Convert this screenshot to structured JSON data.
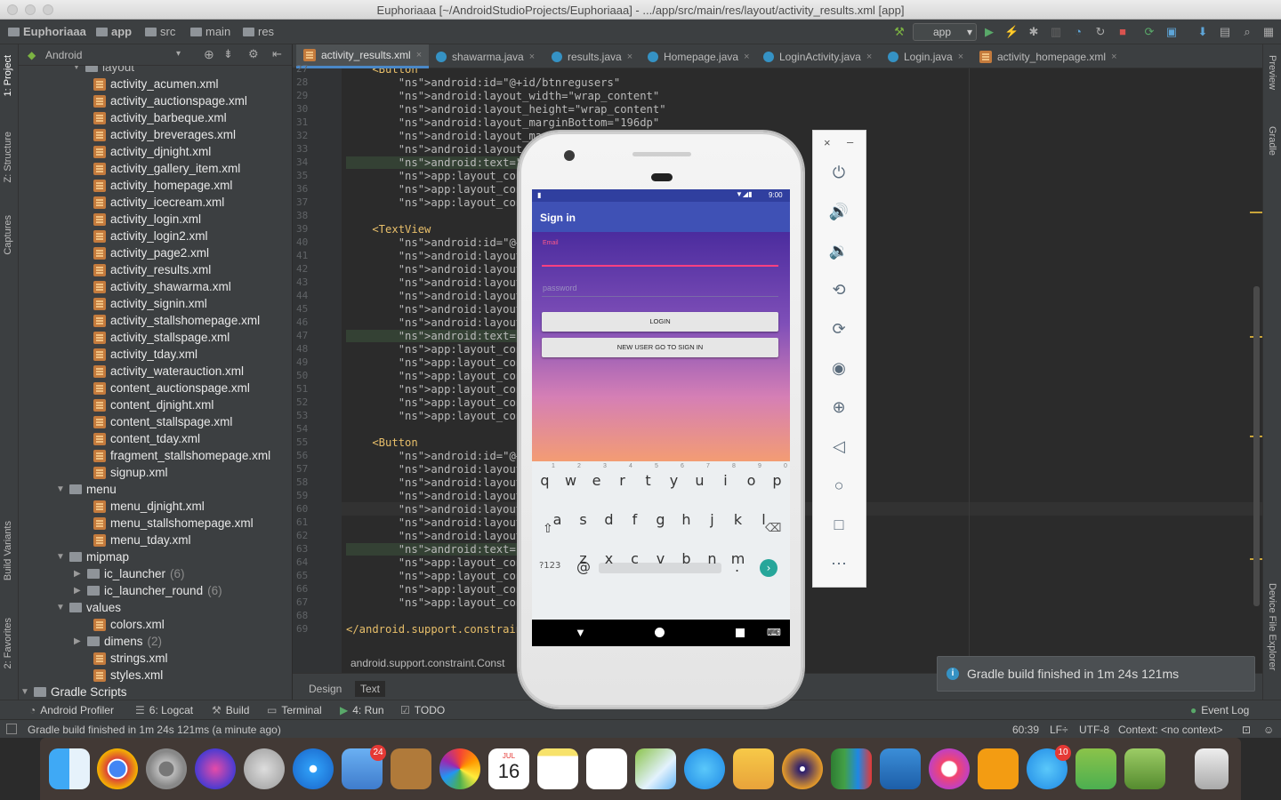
{
  "window": {
    "title": "Euphoriaaa [~/AndroidStudioProjects/Euphoriaaa] - .../app/src/main/res/layout/activity_results.xml [app]"
  },
  "breadcrumbs": [
    "Euphoriaaa",
    "app",
    "src",
    "main",
    "res"
  ],
  "run_config": "app",
  "left_tabs": [
    "1: Project",
    "Z: Structure",
    "Captures",
    "Build Variants",
    "2: Favorites"
  ],
  "right_tabs": [
    "Preview",
    "Gradle",
    "Device File Explorer"
  ],
  "project_panel": {
    "view_selector": "Android",
    "root_partial": "layout",
    "layout_files": [
      "activity_acumen.xml",
      "activity_auctionspage.xml",
      "activity_barbeque.xml",
      "activity_breverages.xml",
      "activity_djnight.xml",
      "activity_gallery_item.xml",
      "activity_homepage.xml",
      "activity_icecream.xml",
      "activity_login.xml",
      "activity_login2.xml",
      "activity_page2.xml",
      "activity_results.xml",
      "activity_shawarma.xml",
      "activity_signin.xml",
      "activity_stallshomepage.xml",
      "activity_stallspage.xml",
      "activity_tday.xml",
      "activity_waterauction.xml",
      "content_auctionspage.xml",
      "content_djnight.xml",
      "content_stallspage.xml",
      "content_tday.xml",
      "fragment_stallshomepage.xml",
      "signup.xml"
    ],
    "menu_folder": "menu",
    "menu_files": [
      "menu_djnight.xml",
      "menu_stallshomepage.xml",
      "menu_tday.xml"
    ],
    "mipmap_folder": "mipmap",
    "mipmap_items": [
      {
        "name": "ic_launcher",
        "count": "(6)"
      },
      {
        "name": "ic_launcher_round",
        "count": "(6)"
      }
    ],
    "values_folder": "values",
    "values_items": [
      {
        "name": "colors.xml",
        "count": ""
      },
      {
        "name": "dimens",
        "count": "(2)"
      },
      {
        "name": "strings.xml",
        "count": ""
      },
      {
        "name": "styles.xml",
        "count": ""
      }
    ],
    "gradle_scripts": "Gradle Scripts"
  },
  "editor_tabs": [
    "activity_results.xml",
    "shawarma.java",
    "results.java",
    "Homepage.java",
    "LoginActivity.java",
    "Login.java",
    "activity_homepage.xml"
  ],
  "line_numbers": [
    "27",
    "28",
    "29",
    "30",
    "31",
    "32",
    "33",
    "34",
    "35",
    "36",
    "37",
    "38",
    "39",
    "40",
    "41",
    "42",
    "43",
    "44",
    "45",
    "46",
    "47",
    "48",
    "49",
    "50",
    "51",
    "52",
    "53",
    "54",
    "55",
    "56",
    "57",
    "58",
    "59",
    "60",
    "61",
    "62",
    "63",
    "64",
    "65",
    "66",
    "67",
    "68",
    "69"
  ],
  "code_lines": [
    {
      "t": "    <Button",
      "c": "tag"
    },
    {
      "t": "        android:id=\"@+id/btnregusers\"",
      "c": "attr"
    },
    {
      "t": "        android:layout_width=\"wrap_content\"",
      "c": "attr"
    },
    {
      "t": "        android:layout_height=\"wrap_content\"",
      "c": "attr"
    },
    {
      "t": "        android:layout_marginBottom=\"196dp\"",
      "c": "attr"
    },
    {
      "t": "        android:layout_marginEnd",
      "c": "attr"
    },
    {
      "t": "        android:layout_margin",
      "c": "attr"
    },
    {
      "t": "        android:text=\"Get re",
      "c": "hl"
    },
    {
      "t": "        app:layout_constrain",
      "c": "attr"
    },
    {
      "t": "        app:layout_constrain",
      "c": "attr"
    },
    {
      "t": "        app:layout_constrain",
      "c": "attr"
    },
    {
      "t": "",
      "c": "attr"
    },
    {
      "t": "    <TextView",
      "c": "tag"
    },
    {
      "t": "        android:id=\"@+id/res",
      "c": "attr"
    },
    {
      "t": "        android:layout_width",
      "c": "attr"
    },
    {
      "t": "        android:layout_heigh",
      "c": "attr"
    },
    {
      "t": "        android:layout_margi",
      "c": "attr"
    },
    {
      "t": "        android:layout_margi",
      "c": "attr"
    },
    {
      "t": "        android:layout_margi",
      "c": "attr"
    },
    {
      "t": "        android:layout_margi",
      "c": "attr"
    },
    {
      "t": "        android:text=\"Pranay",
      "c": "hl"
    },
    {
      "t": "        app:layout_constrain",
      "c": "attr"
    },
    {
      "t": "        app:layout_constrain",
      "c": "attr"
    },
    {
      "t": "        app:layout_constrain",
      "c": "attr"
    },
    {
      "t": "        app:layout_constrain",
      "c": "attr"
    },
    {
      "t": "        app:layout_constrain",
      "c": "attr"
    },
    {
      "t": "        app:layout_constrain",
      "c": "attr"
    },
    {
      "t": "",
      "c": "attr"
    },
    {
      "t": "    <Button",
      "c": "tag"
    },
    {
      "t": "        android:id=\"@+id/bac",
      "c": "attr"
    },
    {
      "t": "        android:layout_width",
      "c": "attr"
    },
    {
      "t": "        android:layout_heigh",
      "c": "attr"
    },
    {
      "t": "        android:layout_margi",
      "c": "attr"
    },
    {
      "t": "        android:layout_margi",
      "c": "attr"
    },
    {
      "t": "        android:layout_margi",
      "c": "attr"
    },
    {
      "t": "        android:layout_margi",
      "c": "attr"
    },
    {
      "t": "        android:text=\"Go bac",
      "c": "hl"
    },
    {
      "t": "        app:layout_constrain",
      "c": "attr"
    },
    {
      "t": "        app:layout_constrain",
      "c": "attr"
    },
    {
      "t": "        app:layout_constrain",
      "c": "attr"
    },
    {
      "t": "        app:layout_constrain",
      "c": "attr"
    },
    {
      "t": "",
      "c": "attr"
    },
    {
      "t": "</android.support.constraint",
      "c": "tag"
    }
  ],
  "editor_breadcrumb": "android.support.constraint.Const",
  "editor_bottom_tabs": [
    "Design",
    "Text"
  ],
  "tool_windows": [
    "Android Profiler",
    "6: Logcat",
    "Build",
    "Terminal",
    "4: Run",
    "TODO"
  ],
  "event_log": "Event Log",
  "notification": "Gradle build finished in 1m 24s 121ms",
  "status": {
    "message": "Gradle build finished in 1m 24s 121ms (a minute ago)",
    "position": "60:39",
    "line_sep": "LF÷",
    "encoding": "UTF-8",
    "context": "Context: <no context>"
  },
  "emulator": {
    "time": "9:00",
    "app_title": "Sign in",
    "email_label": "Email",
    "password_hint": "password",
    "login_button": "LOGIN",
    "signup_button": "NEW USER GO TO SIGN IN",
    "keyboard_row1": [
      "q",
      "w",
      "e",
      "r",
      "t",
      "y",
      "u",
      "i",
      "o",
      "p"
    ],
    "keyboard_nums": [
      "1",
      "2",
      "3",
      "4",
      "5",
      "6",
      "7",
      "8",
      "9",
      "0"
    ],
    "keyboard_row2": [
      "a",
      "s",
      "d",
      "f",
      "g",
      "h",
      "j",
      "k",
      "l"
    ],
    "keyboard_row3": [
      "z",
      "x",
      "c",
      "v",
      "b",
      "n",
      "m"
    ],
    "symbols_key": "?123",
    "at_key": "@",
    "period_key": "."
  },
  "dock": {
    "calendar_month": "JUL",
    "calendar_day": "16",
    "mail_badge": "24",
    "appstore_badge": "10"
  }
}
